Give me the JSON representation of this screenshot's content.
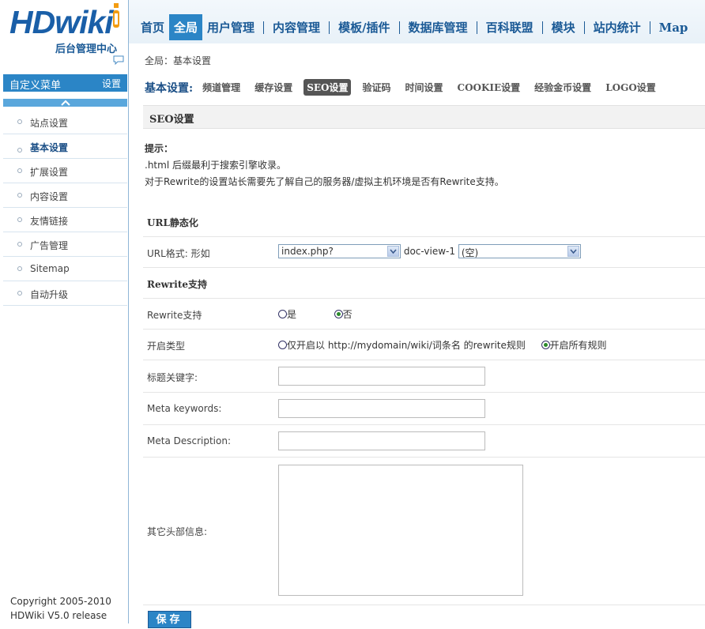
{
  "brand": {
    "logo": "HDwiki",
    "subtitle": "后台管理中心"
  },
  "sidebar": {
    "custom_menu": "自定义菜单",
    "setting": "设置",
    "items": [
      {
        "label": "站点设置"
      },
      {
        "label": "基本设置"
      },
      {
        "label": "扩展设置"
      },
      {
        "label": "内容设置"
      },
      {
        "label": "友情链接"
      },
      {
        "label": "广告管理"
      },
      {
        "label": "Sitemap"
      },
      {
        "label": "自动升级"
      }
    ],
    "copyright_line1": "Copyright 2005-2010",
    "copyright_line2": "HDWiki V5.0 release"
  },
  "topnav": {
    "items": [
      {
        "label": "首页"
      },
      {
        "label": "全局"
      },
      {
        "label": "用户管理"
      },
      {
        "label": "内容管理"
      },
      {
        "label": "模板/插件"
      },
      {
        "label": "数据库管理"
      },
      {
        "label": "百科联盟"
      },
      {
        "label": "模块"
      },
      {
        "label": "站内统计"
      },
      {
        "label": "Map"
      }
    ]
  },
  "main": {
    "breadcrumb": "全局：基本设置",
    "subnav_heading": "基本设置:",
    "tabs": [
      {
        "label": "频道管理"
      },
      {
        "label": "缓存设置"
      },
      {
        "label": "SEO设置"
      },
      {
        "label": "验证码"
      },
      {
        "label": "时间设置"
      },
      {
        "label": "COOKIE设置"
      },
      {
        "label": "经验金币设置"
      },
      {
        "label": "LOGO设置"
      }
    ],
    "section_title": "SEO设置",
    "hint_title": "提示：",
    "hint_line1": ".html 后缀最利于搜索引擎收录。",
    "hint_line2": "对于Rewrite的设置站长需要先了解自己的服务器/虚拟主机环境是否有Rewrite支持。",
    "url_static_title": "URL静态化",
    "url_format_label": "URL格式: 形如",
    "url_select1": "index.php?",
    "url_middle": "doc-view-1",
    "url_select2": "(空)",
    "rewrite_title": "Rewrite支持",
    "rewrite_label": "Rewrite支持",
    "rewrite_yes": "是",
    "rewrite_no": "否",
    "open_type_label": "开启类型",
    "open_type_opt1": "仅开启以 http://mydomain/wiki/词条名 的rewrite规则",
    "open_type_opt2": "开启所有规则",
    "title_keywords_label": "标题关键字:",
    "meta_keywords_label": "Meta keywords:",
    "meta_description_label": "Meta Description:",
    "other_head_label": "其它头部信息:",
    "save_label": "保存"
  }
}
